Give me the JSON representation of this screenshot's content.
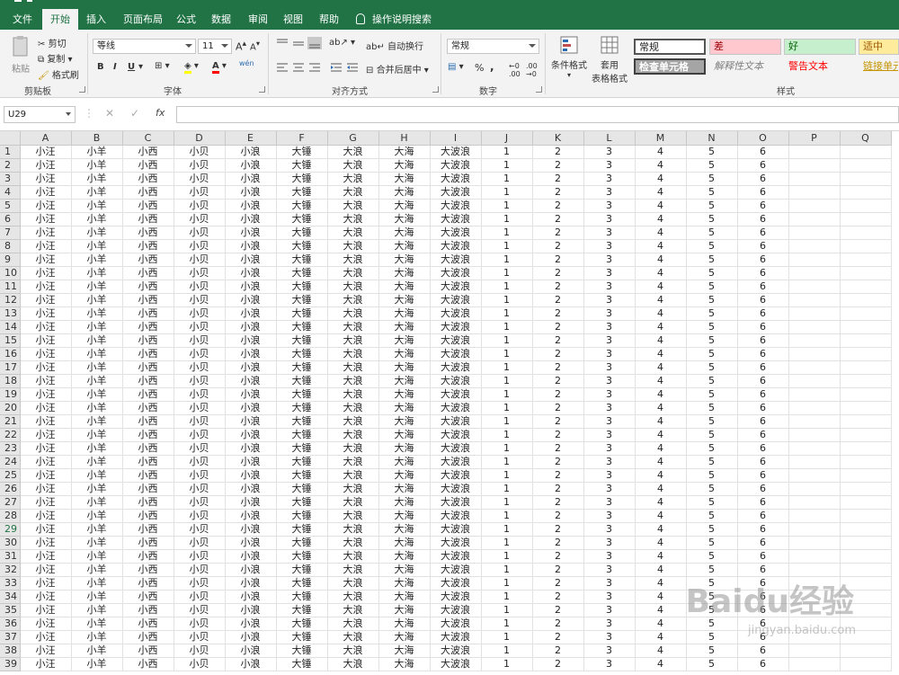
{
  "tabs": [
    "文件",
    "开始",
    "插入",
    "页面布局",
    "公式",
    "数据",
    "审阅",
    "视图",
    "帮助"
  ],
  "active_tab": "开始",
  "tell_me": "操作说明搜索",
  "clipboard": {
    "paste": "粘贴",
    "cut": "剪切",
    "copy": "复制",
    "format_painter": "格式刷",
    "label": "剪贴板"
  },
  "font": {
    "name": "等线",
    "size": "11",
    "label": "字体",
    "bold": "B",
    "italic": "I",
    "underline": "U",
    "phonetic": "wén"
  },
  "alignment": {
    "wrap_text": "自动换行",
    "merge_center": "合并后居中",
    "label": "对齐方式"
  },
  "number": {
    "format": "常规",
    "percent": "%",
    "comma": ",",
    "label": "数字"
  },
  "styles": {
    "conditional_format": "条件格式",
    "table_format_1": "套用",
    "table_format_2": "表格格式",
    "normal": "常规",
    "bad": "差",
    "good": "好",
    "neutral": "适中",
    "check_cell": "检查单元格",
    "explanatory": "解释性文本",
    "warning": "警告文本",
    "hyperlink": "链接单元",
    "label": "样式"
  },
  "formula_bar": {
    "name_box": "U29",
    "cancel": "✕",
    "enter": "✓",
    "fx": "fx",
    "value": ""
  },
  "columns": [
    "A",
    "B",
    "C",
    "D",
    "E",
    "F",
    "G",
    "H",
    "I",
    "J",
    "K",
    "L",
    "M",
    "N",
    "O",
    "P",
    "Q"
  ],
  "row_values": [
    "小汪",
    "小羊",
    "小西",
    "小贝",
    "小浪",
    "大锤",
    "大浪",
    "大海",
    "大波浪",
    "1",
    "2",
    "3",
    "4",
    "5",
    "6",
    "",
    ""
  ],
  "row_count": 39,
  "selected_row": 29,
  "watermark": "Baidu经验",
  "watermark_sub": "jingyan.baidu.com",
  "colors": {
    "accent": "#217346",
    "bad_bg": "#ffc7ce",
    "bad_fg": "#9c0006",
    "good_bg": "#c6efce",
    "good_fg": "#006100",
    "neutral_bg": "#ffeb9c",
    "neutral_fg": "#9c5700",
    "check_bg": "#a5a5a5"
  }
}
